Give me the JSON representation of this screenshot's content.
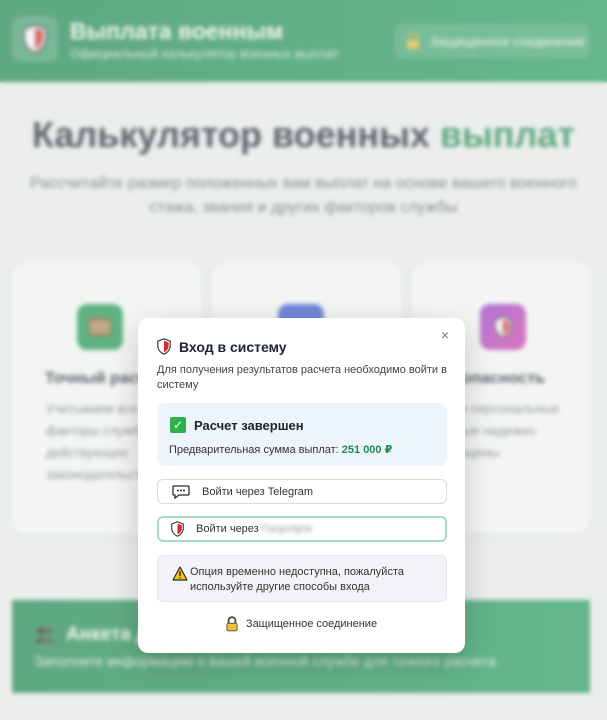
{
  "header": {
    "brand_title": "Выплата военным",
    "brand_subtitle": "Официальный калькулятор военных выплат",
    "secure_label": "Защищенное соединение"
  },
  "hero": {
    "title_main": "Калькулятор военных ",
    "title_accent": "выплат",
    "subtitle": "Рассчитайте размер положенных вам выплат на основе вашего военного стажа, звания и других факторов службы"
  },
  "features": [
    {
      "title": "Точный расчет",
      "desc": "Учитываем все факторы службы и действующее законодательство",
      "icon": "abacus-icon"
    },
    {
      "title": "",
      "desc": "",
      "icon": "speed-icon"
    },
    {
      "title": "Безопасность",
      "desc": "Ваши персональные данные надежно защищены",
      "icon": "shield-icon"
    }
  ],
  "form_section": {
    "title": "Анкета для расчета",
    "subtitle": "Заполните информацию о вашей военной службе для точного расчета"
  },
  "modal": {
    "title": "Вход в систему",
    "description": "Для получения результатов расчета необходимо войти в систему",
    "result_title": "Расчет завершен",
    "result_sum_label": "Предварительная сумма выплат: ",
    "result_sum_value": "251 000 ₽",
    "telegram_button": "Войти через Telegram",
    "other_button": "Войти через",
    "other_button_blurred": "Госуслуги",
    "warning": "Опция временно недоступна, пожалуйста используйте другие способы входа",
    "footer": "Защищенное соединение",
    "close_glyph": "×"
  },
  "colors": {
    "brand": "#1d8a52",
    "accent_text": "#1d8a52",
    "result_bg": "#eef4fb",
    "check": "#2fb24d"
  }
}
